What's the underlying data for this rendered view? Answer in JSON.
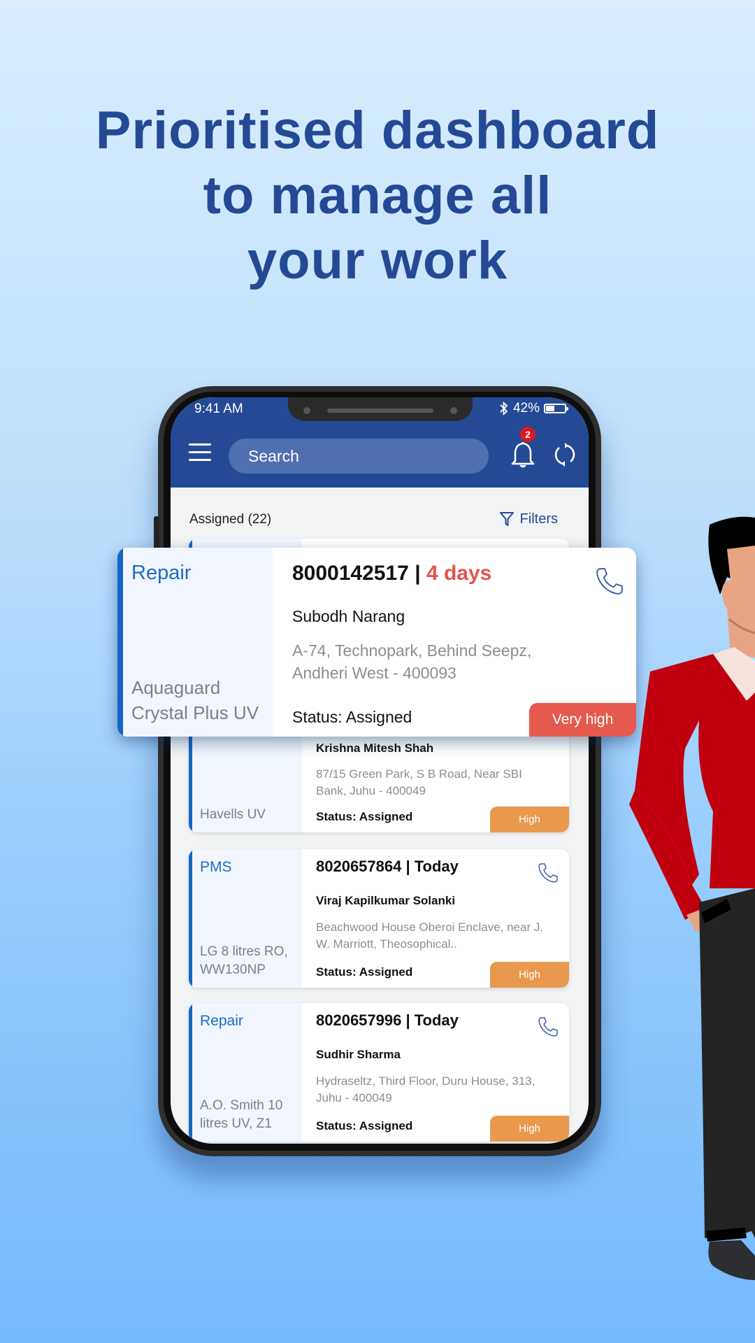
{
  "headline": {
    "lines": [
      "Prioritised dashboard",
      "to manage all",
      "your work"
    ]
  },
  "colors": {
    "brand_blue": "#244a96",
    "accent_blue": "#1565c7",
    "very_high": "#e5594f",
    "high": "#e8994d",
    "age_red": "#e5544a",
    "badge_red": "#e0161f"
  },
  "status_bar": {
    "time": "9:41 AM",
    "bluetooth_icon": "bluetooth-icon",
    "battery_percent": "42%",
    "battery_level": 0.42
  },
  "app_header": {
    "menu_icon": "hamburger-menu-icon",
    "search_placeholder": "Search",
    "notification_icon": "bell-icon",
    "notification_count": "2",
    "sync_icon": "refresh-icon"
  },
  "list": {
    "title": "Assigned (22)",
    "filters_label": "Filters",
    "filters_icon": "filter-icon"
  },
  "highlighted_job": {
    "type": "Repair",
    "product": "Aquaguard Crystal Plus UV",
    "job_id": "8000142517",
    "separator": " | ",
    "age": "4 days",
    "customer": "Subodh Narang",
    "address": "A-74, Technopark, Behind Seepz, Andheri West - 400093",
    "status": "Status: Assigned",
    "priority": "Very high"
  },
  "jobs": [
    {
      "type": "",
      "product": "Havells UV",
      "job_line": "",
      "customer": "Krishna Mitesh Shah",
      "address": "87/15 Green Park, S B  Road, Near SBI Bank, Juhu - 400049",
      "status": "Status: Assigned",
      "priority": "High"
    },
    {
      "type": "PMS",
      "product": "LG 8 litres RO, WW130NP",
      "job_line": "8020657864 | Today",
      "customer": "Viraj Kapilkumar Solanki",
      "address": "Beachwood House Oberoi Enclave, near J. W. Marriott, Theosophical..",
      "status": "Status: Assigned",
      "priority": "High"
    },
    {
      "type": "Repair",
      "product": "A.O. Smith 10 litres UV, Z1",
      "job_line": "8020657996 | Today",
      "customer": "Sudhir Sharma",
      "address": "Hydraseltz, Third Floor, Duru House, 313, Juhu - 400049",
      "status": "Status: Assigned",
      "priority": "High"
    }
  ]
}
